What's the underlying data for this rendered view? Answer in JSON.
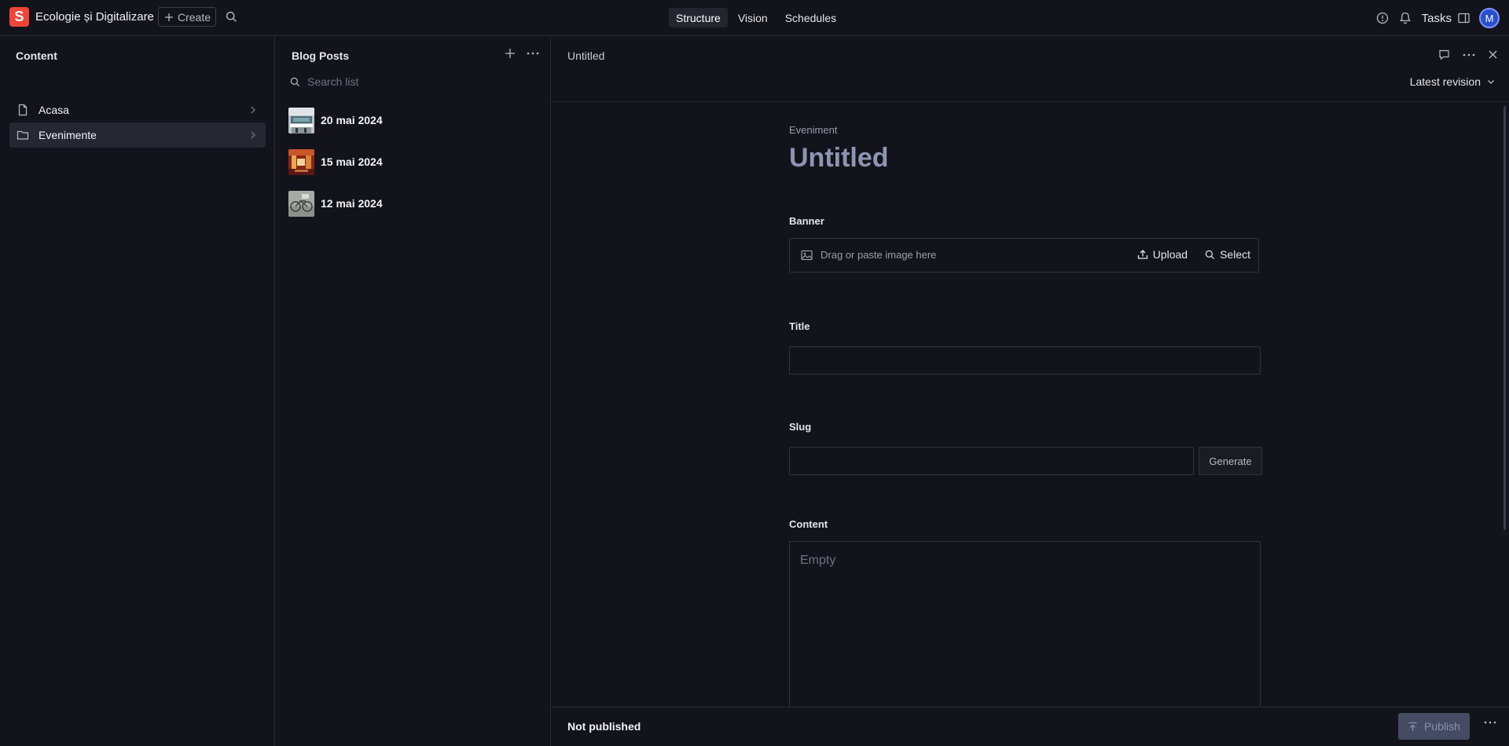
{
  "topbar": {
    "logo_letter": "S",
    "workspace_name": "Ecologie și Digitalizare",
    "create_label": "Create",
    "tabs": [
      {
        "label": "Structure",
        "active": true
      },
      {
        "label": "Vision",
        "active": false
      },
      {
        "label": "Schedules",
        "active": false
      }
    ],
    "tasks_label": "Tasks",
    "avatar_initial": "M",
    "icons": [
      "search-icon",
      "help-icon",
      "notifications-icon",
      "panel-toggle-icon"
    ]
  },
  "content_pane": {
    "title": "Content",
    "items": [
      {
        "label": "Acasa",
        "icon": "document-icon",
        "selected": false
      },
      {
        "label": "Evenimente",
        "icon": "folder-icon",
        "selected": true
      }
    ]
  },
  "list_pane": {
    "title": "Blog Posts",
    "search_placeholder": "Search list",
    "posts": [
      {
        "label": "20 mai 2024",
        "thumb": "conference-room-thumbnail"
      },
      {
        "label": "15 mai 2024",
        "thumb": "red-hall-thumbnail"
      },
      {
        "label": "12 mai 2024",
        "thumb": "bicycle-thumbnail"
      }
    ]
  },
  "document": {
    "header_title": "Untitled",
    "revision_label": "Latest revision",
    "doc_type": "Eveniment",
    "title": "Untitled",
    "fields": {
      "banner": {
        "label": "Banner",
        "hint": "Drag or paste image here",
        "upload_label": "Upload",
        "select_label": "Select"
      },
      "title": {
        "label": "Title",
        "value": ""
      },
      "slug": {
        "label": "Slug",
        "value": "",
        "generate_label": "Generate"
      },
      "content": {
        "label": "Content",
        "placeholder": "Empty"
      }
    },
    "footer": {
      "status": "Not published",
      "publish_label": "Publish"
    }
  },
  "colors": {
    "background": "#13141b",
    "brand": "#f04438",
    "selected_row": "#252833",
    "avatar": "#2b4ecf",
    "publish_disabled": "#454b63"
  }
}
